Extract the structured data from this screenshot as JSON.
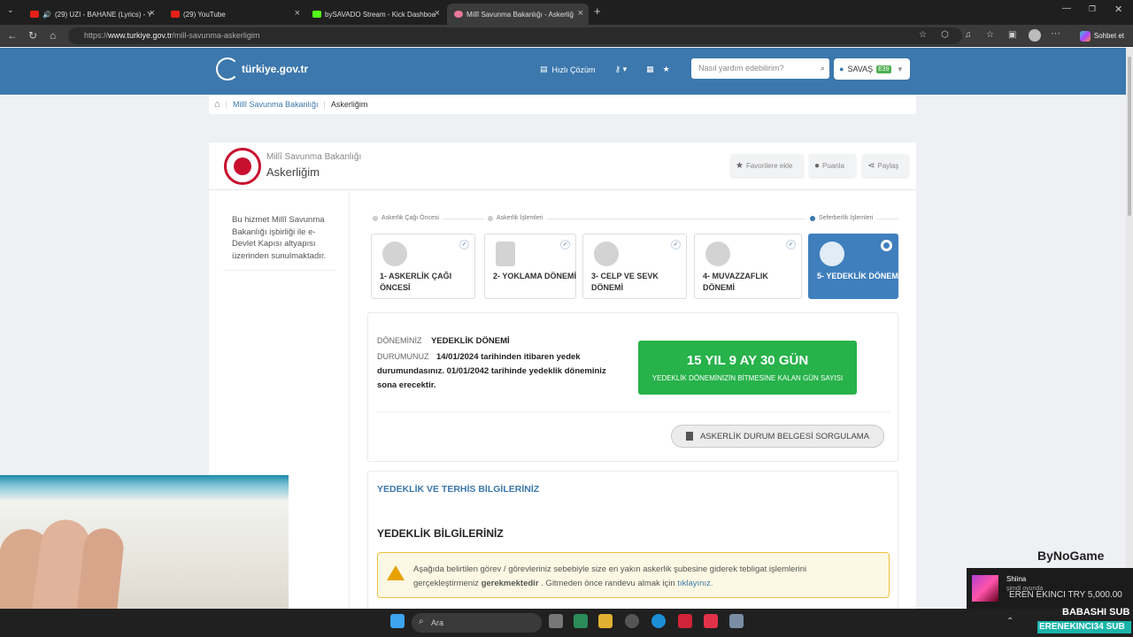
{
  "browser": {
    "tabs": [
      {
        "label": "(29) UZI - BAHANE (Lyrics) - Y",
        "icon": "youtube-icon"
      },
      {
        "label": "(29) YouTube",
        "icon": "youtube-icon"
      },
      {
        "label": "bySAVADO Stream - Kick Dashboa",
        "icon": "kick-icon"
      },
      {
        "label": "Millî Savunma Bakanlığı - Askerliğ",
        "icon": "turkiye-gov-icon"
      }
    ],
    "url_prefix": "https://",
    "url_domain": "www.turkiye.gov.tr",
    "url_path": "/mill-savunma-askerligim",
    "copilot_label": "Sohbet et"
  },
  "header": {
    "logo_text": "türkiye.gov.tr",
    "quick_label": "Hızlı Çözüm",
    "search_placeholder": "Nasıl yardım edebilirim?",
    "user_name": "SAVAŞ",
    "user_badge": "E39"
  },
  "breadcrumb": {
    "items": [
      "Millî Savunma Bakanlığı",
      "Askerliğim"
    ]
  },
  "service": {
    "institution": "Millî Savunma Bakanlığı",
    "title": "Askerliğim",
    "favorite_label": "Favorilere ekle",
    "rate_label": "Puanla",
    "share_label": "Paylaş",
    "side_info": "Bu hizmet Millî Savunma Bakanlığı işbirliği ile e-Devlet Kapısı altyapısı üzerinden sunulmaktadır."
  },
  "phases": [
    "Askerlik Çağı Öncesi",
    "Askerlik İşlemleri",
    "Seferberlik İşlemleri"
  ],
  "steps": [
    {
      "label": "1- ASKERLİK ÇAĞI ÖNCESİ",
      "done": true
    },
    {
      "label": "2- YOKLAMA DÖNEMİ",
      "done": true
    },
    {
      "label": "3- CELP VE SEVK DÖNEMİ",
      "done": true
    },
    {
      "label": "4- MUVAZZAFLIK DÖNEMİ",
      "done": true
    },
    {
      "label": "5- YEDEKLİK DÖNEMİ",
      "active": true
    }
  ],
  "status": {
    "period_key": "DÖNEMİNİZ",
    "period_value": "YEDEKLİK DÖNEMİ",
    "state_key": "DURUMUNUZ",
    "state_value": "14/01/2024 tarihinden itibaren yedek durumundasınız. 01/01/2042 tarihinde yedeklik döneminiz sona erecektir.",
    "remaining": "15 YIL 9 AY 30 GÜN",
    "remaining_caption": "YEDEKLİK DÖNEMİNİZİN BİTMESİNE KALAN GÜN SAYISI",
    "query_button": "ASKERLİK DURUM BELGESİ SORGULAMA"
  },
  "details": {
    "section_title": "YEDEKLİK VE TERHİS BİLGİLERİNİZ",
    "subtitle": "YEDEKLİK BİLGİLERİNİZ",
    "warning_pre": "Aşağıda belirtilen görev / görevleriniz sebebiyle size en yakın askerlik şubesine giderek tebligat işlemlerini gerçekleştirmeniz",
    "warning_bold": "gerekmektedir",
    "warning_post": ". Gitmeden önce randevu almak için",
    "warning_link": "tıklayınız."
  },
  "stream": {
    "sponsor": "ByNoGame",
    "alert_name": "Shiina",
    "alert_sub": "şimdi oyunda",
    "donation": "EREN EKINCI  TRY 5,000.00",
    "babashi": "BABASHI  SUB",
    "sub_name": "ERENEKINCI34  SUB"
  },
  "taskbar": {
    "search_label": "Ara"
  },
  "colors": {
    "header_blue": "#3c78ad",
    "active_step": "#3f7fbd",
    "remaining_green": "#27b24a",
    "warning_bg": "#fcf8e3"
  }
}
